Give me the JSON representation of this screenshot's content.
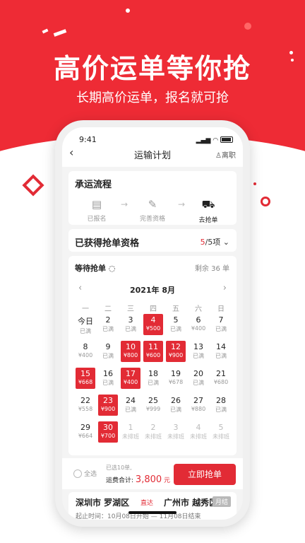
{
  "hero": {
    "title": "高价运单等你抢",
    "subtitle": "长期高价运单，报名就可抢"
  },
  "status": {
    "time": "9:41"
  },
  "nav": {
    "back": "‹",
    "title": "运输计划",
    "right": "离职"
  },
  "process": {
    "title": "承运流程",
    "steps": [
      {
        "label": "已报名",
        "icon": "document-icon"
      },
      {
        "label": "完善资格",
        "icon": "edit-icon"
      },
      {
        "label": "去抢单",
        "icon": "truck-icon"
      }
    ]
  },
  "qualification": {
    "label": "已获得抢单资格",
    "count": "5",
    "suffix": "/5项"
  },
  "waiting": {
    "title": "等待抢单",
    "remain": "剩余 36 单"
  },
  "calendar": {
    "month": "2021年 8月",
    "weekdays": [
      "一",
      "二",
      "三",
      "四",
      "五",
      "六",
      "日"
    ],
    "rows": [
      [
        {
          "d": "今日",
          "s": "已满"
        },
        {
          "d": "2",
          "s": "已满"
        },
        {
          "d": "3",
          "s": "已满"
        },
        {
          "d": "4",
          "s": "¥500",
          "sel": true
        },
        {
          "d": "5",
          "s": "已满"
        },
        {
          "d": "6",
          "s": "¥400"
        },
        {
          "d": "7",
          "s": "已满"
        }
      ],
      [
        {
          "d": "8",
          "s": "¥400"
        },
        {
          "d": "9",
          "s": "已满"
        },
        {
          "d": "10",
          "s": "¥800",
          "sel": true
        },
        {
          "d": "11",
          "s": "¥600",
          "sel": true
        },
        {
          "d": "12",
          "s": "¥900",
          "sel": true
        },
        {
          "d": "13",
          "s": "已满"
        },
        {
          "d": "14",
          "s": "已满"
        }
      ],
      [
        {
          "d": "15",
          "s": "¥668",
          "sel": true
        },
        {
          "d": "16",
          "s": "已满"
        },
        {
          "d": "17",
          "s": "¥400",
          "sel": true
        },
        {
          "d": "18",
          "s": "已满"
        },
        {
          "d": "19",
          "s": "¥678"
        },
        {
          "d": "20",
          "s": "已满"
        },
        {
          "d": "21",
          "s": "¥680"
        }
      ],
      [
        {
          "d": "22",
          "s": "¥558"
        },
        {
          "d": "23",
          "s": "¥900",
          "sel": true
        },
        {
          "d": "24",
          "s": "已满"
        },
        {
          "d": "25",
          "s": "¥999"
        },
        {
          "d": "26",
          "s": "已满"
        },
        {
          "d": "27",
          "s": "¥880"
        },
        {
          "d": "28",
          "s": "已满"
        }
      ],
      [
        {
          "d": "29",
          "s": "¥664"
        },
        {
          "d": "30",
          "s": "¥700",
          "sel": true
        },
        {
          "d": "1",
          "s": "未排班",
          "off": true
        },
        {
          "d": "2",
          "s": "未排班",
          "off": true
        },
        {
          "d": "3",
          "s": "未排班",
          "off": true
        },
        {
          "d": "4",
          "s": "未排班",
          "off": true
        },
        {
          "d": "5",
          "s": "未排班",
          "off": true
        }
      ]
    ]
  },
  "footer": {
    "select_all": "全选",
    "selected": "已选10单,",
    "total_label": "运费合计:",
    "total": "3,800",
    "unit": "元",
    "grab": "立即抢单"
  },
  "route": {
    "from": "深圳市 罗湖区",
    "tag": "直达",
    "to": "广州市 越秀区",
    "badge": "月结",
    "time": "起止时间：10月08日开始 — 11月08日结束"
  },
  "colors": {
    "brand": "#e22b35",
    "hero": "#ee2b35"
  }
}
